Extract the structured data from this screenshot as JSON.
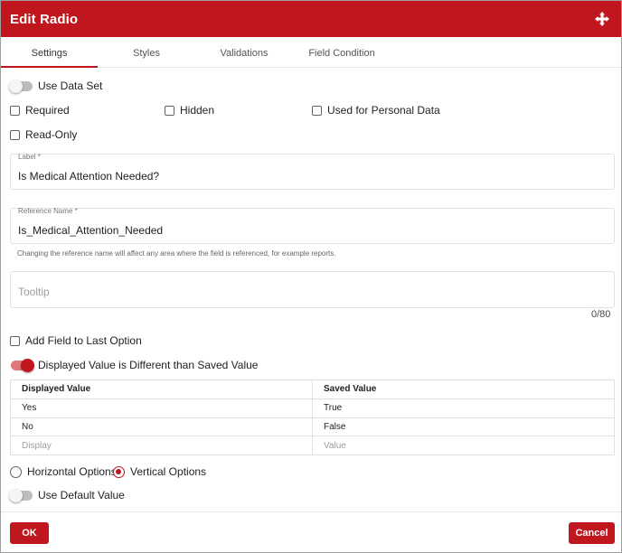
{
  "dialog": {
    "title": "Edit Radio",
    "move_icon": "move-arrows-icon",
    "accent_color": "#c0161e"
  },
  "tabs": [
    {
      "label": "Settings",
      "active": true
    },
    {
      "label": "Styles",
      "active": false
    },
    {
      "label": "Validations",
      "active": false
    },
    {
      "label": "Field Condition",
      "active": false
    }
  ],
  "settings": {
    "use_data_set": {
      "label": "Use Data Set",
      "on": false
    },
    "required": {
      "label": "Required",
      "checked": false
    },
    "hidden": {
      "label": "Hidden",
      "checked": false
    },
    "personal_data": {
      "label": "Used for Personal Data",
      "checked": false
    },
    "read_only": {
      "label": "Read-Only",
      "checked": false
    },
    "label_field": {
      "label": "Label *",
      "value": "Is Medical Attention Needed?"
    },
    "reference_field": {
      "label": "Reference Name *",
      "value": "Is_Medical_Attention_Needed"
    },
    "reference_hint": "Changing the reference name will affect any area where the field is referenced, for example reports.",
    "tooltip_field": {
      "placeholder": "Tooltip",
      "counter": "0/80"
    },
    "add_field_last": {
      "label": "Add Field to Last Option",
      "checked": false
    },
    "displayed_diff": {
      "label": "Displayed Value is Different than Saved Value",
      "on": true
    },
    "options_table": {
      "headers": [
        "Displayed Value",
        "Saved Value"
      ],
      "rows": [
        [
          "Yes",
          "True"
        ],
        [
          "No",
          "False"
        ]
      ],
      "new_row_placeholders": [
        "Display",
        "Value"
      ]
    },
    "orientation": {
      "horizontal_label": "Horizontal Options",
      "vertical_label": "Vertical Options",
      "selected": "Vertical Options"
    },
    "use_default_value": {
      "label": "Use Default Value",
      "on": false
    }
  },
  "footer": {
    "ok_label": "OK",
    "cancel_label": "Cancel"
  }
}
